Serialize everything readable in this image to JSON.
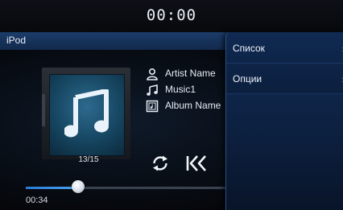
{
  "status_bar": {
    "clock": "00:00"
  },
  "title_bar": {
    "title": "iPod"
  },
  "player": {
    "artist": "Artist Name",
    "track": "Music1",
    "album": "Album Name",
    "track_counter": "13/15",
    "elapsed": "00:34",
    "progress_fraction": 0.25,
    "icons": {
      "artist": "person-icon",
      "track": "music-note-icon",
      "album": "album-icon",
      "repeat": "repeat-icon",
      "previous": "previous-track-icon",
      "cover": "music-note-icon"
    }
  },
  "menu": {
    "items": [
      {
        "label": "Список",
        "chevron": "›"
      },
      {
        "label": "Опции",
        "chevron": "›"
      }
    ]
  },
  "colors": {
    "accent": "#2a7bd6",
    "title_bar": "#1c3c6a",
    "menu_bg": "#102a52"
  }
}
